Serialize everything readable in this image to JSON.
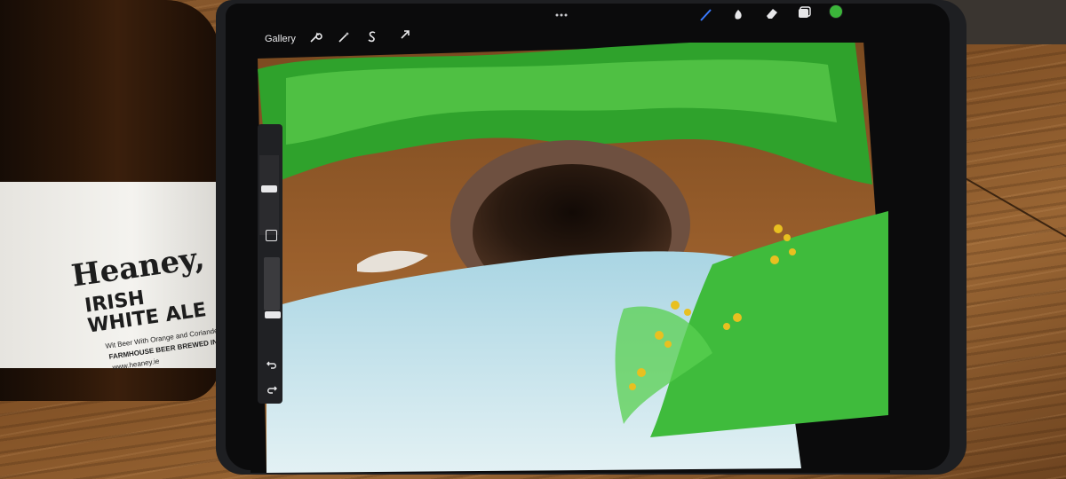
{
  "app": {
    "gallery_label": "Gallery",
    "tools_left": [
      "wrench-icon",
      "magic-wand-icon",
      "selection-s-icon",
      "transform-arrow-icon"
    ],
    "tools_right": [
      "brush-icon",
      "smudge-icon",
      "eraser-icon",
      "layers-icon",
      "color-swatch-icon"
    ],
    "active_color": "#3bb53a",
    "sidebar": {
      "buttons": [
        "brush-size-slider",
        "modify-square-button",
        "opacity-slider",
        "undo-button",
        "redo-button"
      ],
      "undo_icon": "undo-icon",
      "redo_icon": "redo-icon"
    }
  },
  "bottle_label": {
    "brand": "Heaney,",
    "name_line1": "IRISH",
    "name_line2": "WHITE ALE",
    "tagline": "Wit Beer With Orange and Coriander",
    "subline": "FARMHOUSE BEER BREWED IN IRELAND",
    "url": "www.heaney.ie"
  },
  "colors": {
    "grass": "#3bb53a",
    "earth": "#8a5428",
    "water": "#cfe8ef",
    "tunnel": "#2a1a10",
    "flowers": "#e8c020"
  }
}
